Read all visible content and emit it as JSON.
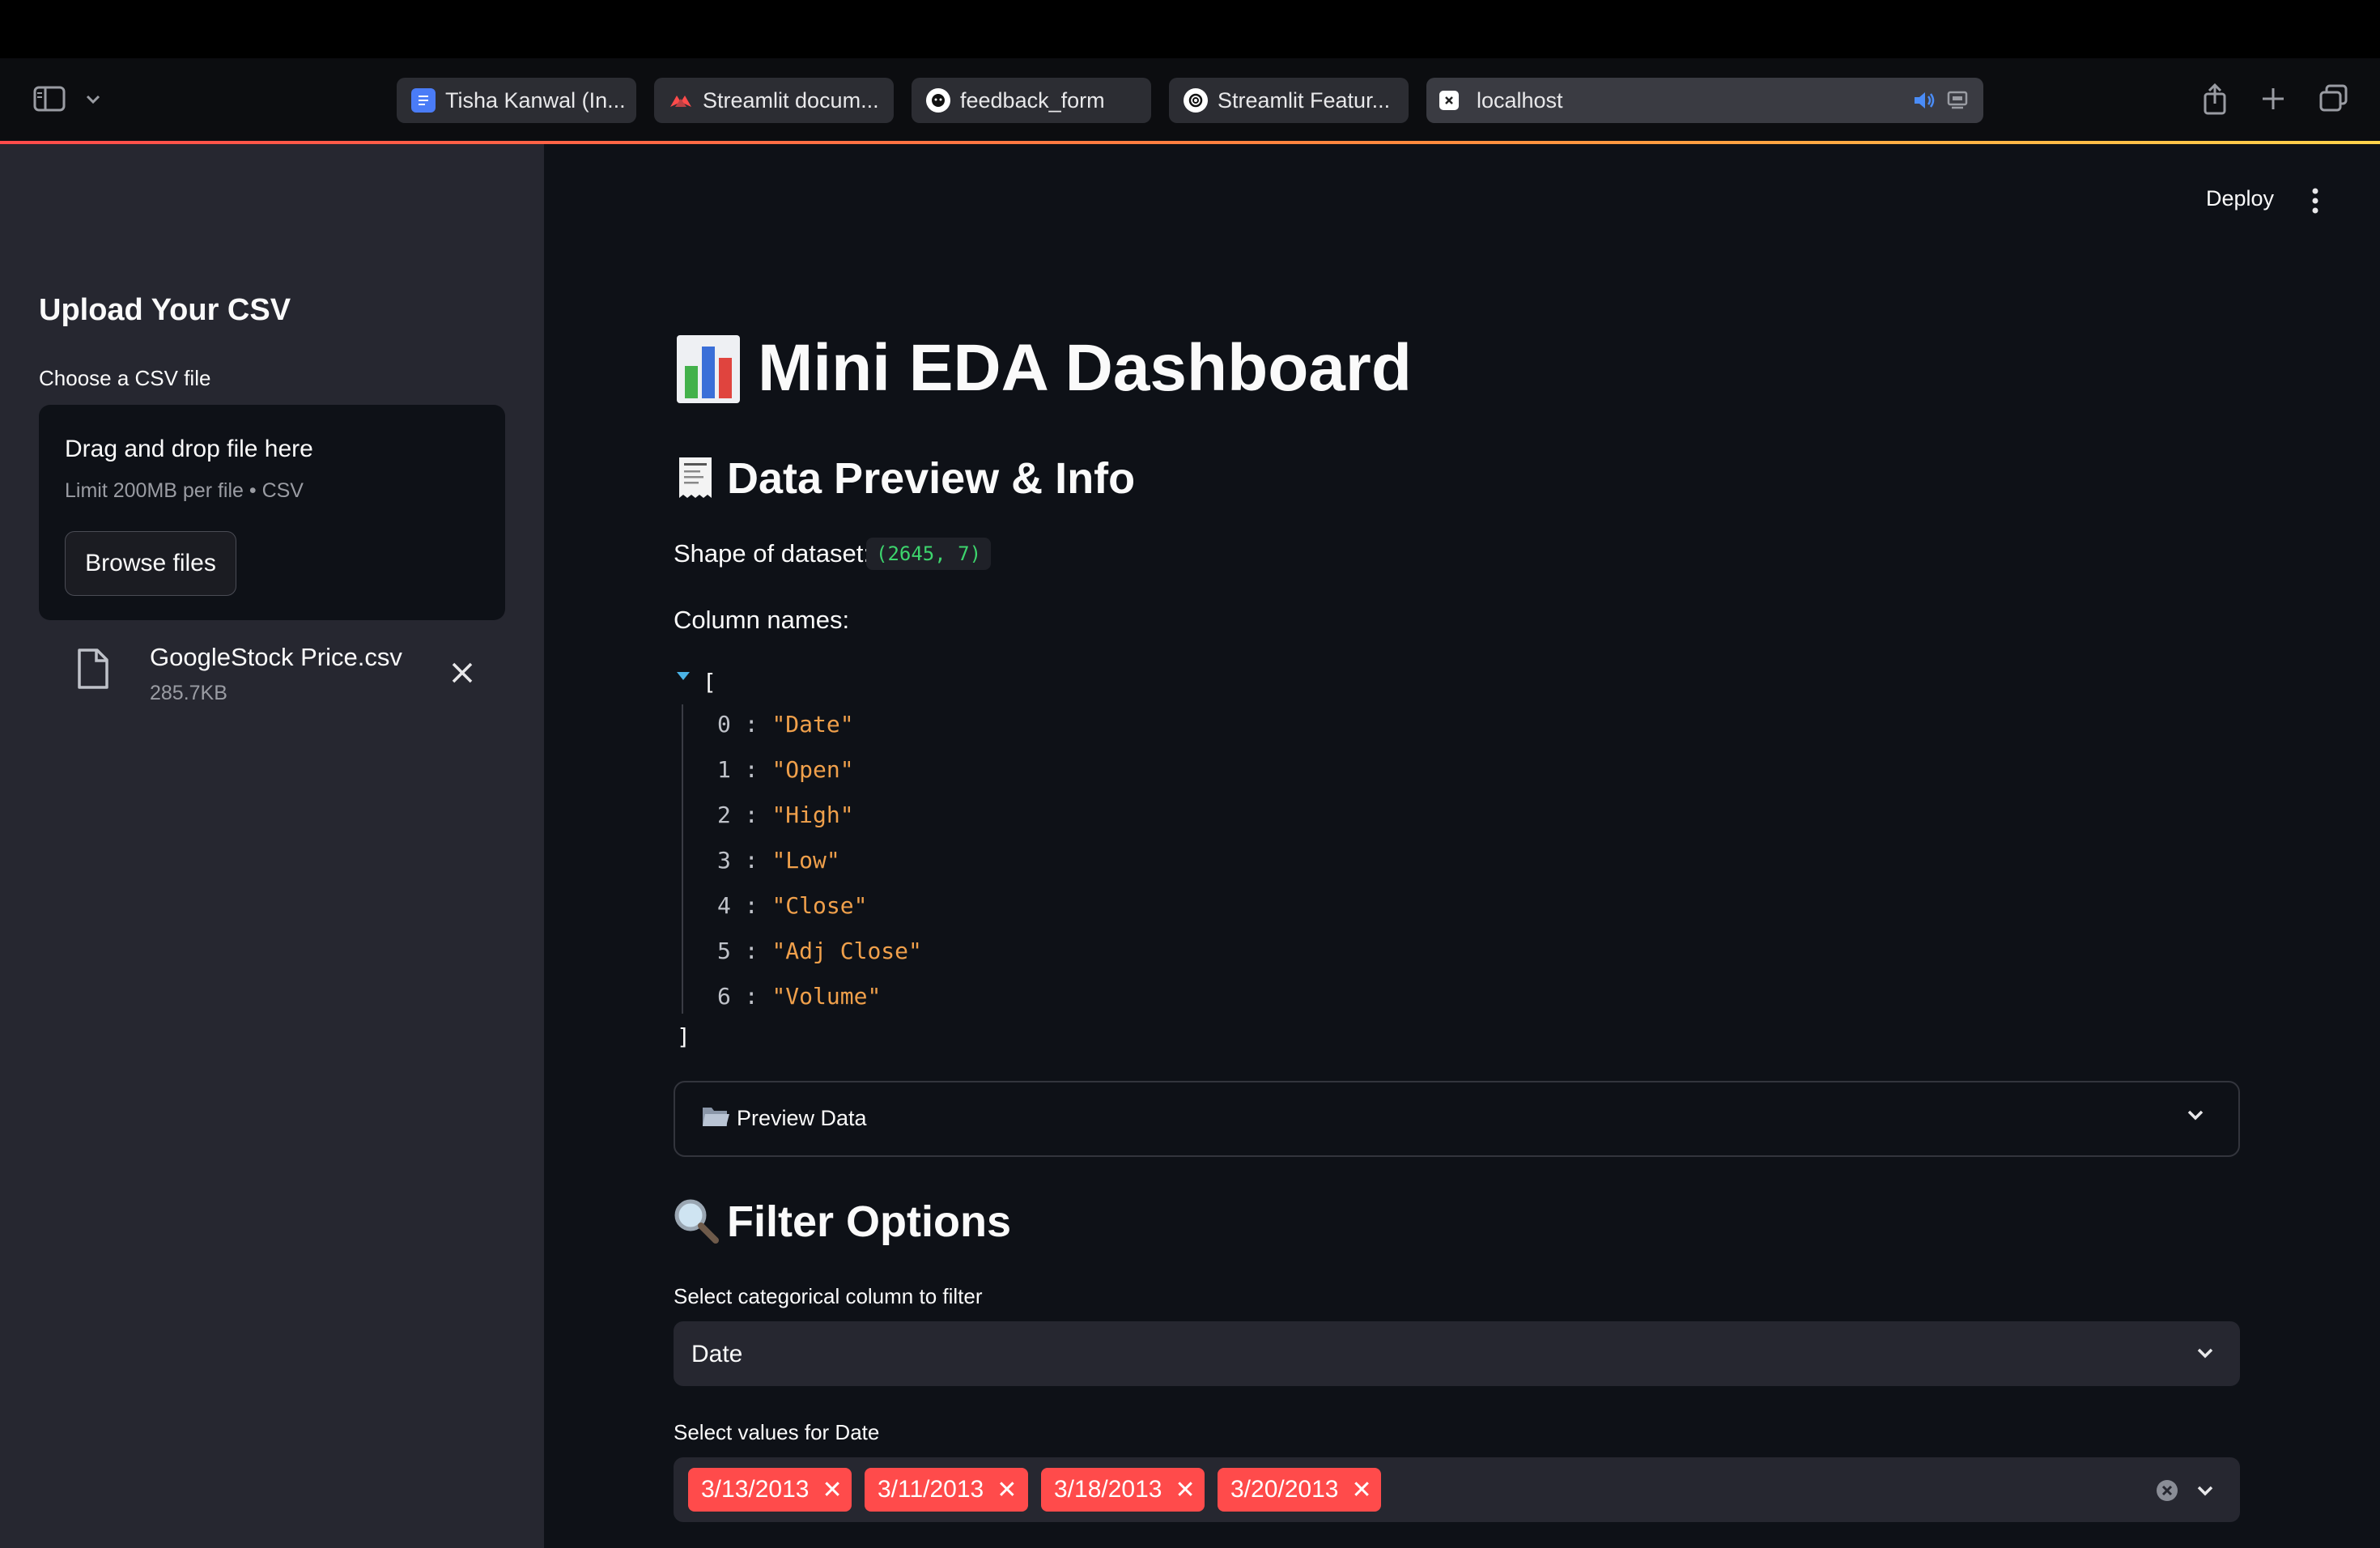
{
  "browser": {
    "tabs": [
      {
        "label": "Tisha Kanwal (In...",
        "icon": "docs-icon",
        "color": "#4a7cf7"
      },
      {
        "label": "Streamlit docum...",
        "icon": "streamlit-icon",
        "color": "#ff4b4b"
      },
      {
        "label": "feedback_form",
        "icon": "github-icon",
        "color": "#ffffff"
      },
      {
        "label": "Streamlit Featur...",
        "icon": "openai-icon",
        "color": "#ffffff"
      },
      {
        "label": "localhost",
        "icon": "close-box-icon",
        "color": "#ffffff"
      }
    ],
    "active_tab": 4
  },
  "header": {
    "deploy_label": "Deploy"
  },
  "sidebar": {
    "title": "Upload Your CSV",
    "uploader_label": "Choose a CSV file",
    "drop_text": "Drag and drop file here",
    "limit_text": "Limit 200MB per file • CSV",
    "browse_label": "Browse files",
    "file_name": "GoogleStock Price.csv",
    "file_size": "285.7KB"
  },
  "main": {
    "title": "Mini EDA Dashboard",
    "title_icon": "bar-chart-emoji",
    "section1_title": "Data Preview & Info",
    "section1_icon": "receipt-emoji",
    "shape_label": "Shape of dataset:",
    "shape_value": "(2645, 7)",
    "columns_label": "Column names:",
    "json_open": "[",
    "json_close": "]",
    "columns": [
      {
        "index": "0",
        "value": "\"Date\""
      },
      {
        "index": "1",
        "value": "\"Open\""
      },
      {
        "index": "2",
        "value": "\"High\""
      },
      {
        "index": "3",
        "value": "\"Low\""
      },
      {
        "index": "4",
        "value": "\"Close\""
      },
      {
        "index": "5",
        "value": "\"Adj Close\""
      },
      {
        "index": "6",
        "value": "\"Volume\""
      }
    ],
    "preview_label": "Preview Data",
    "section2_title": "Filter Options",
    "section2_icon": "magnifier-emoji",
    "cat_select_label": "Select categorical column to filter",
    "cat_select_value": "Date",
    "values_label": "Select values for Date",
    "chips": [
      "3/13/2013",
      "3/11/2013",
      "3/18/2013",
      "3/20/2013"
    ],
    "accent_color": "#ff4b4b"
  }
}
